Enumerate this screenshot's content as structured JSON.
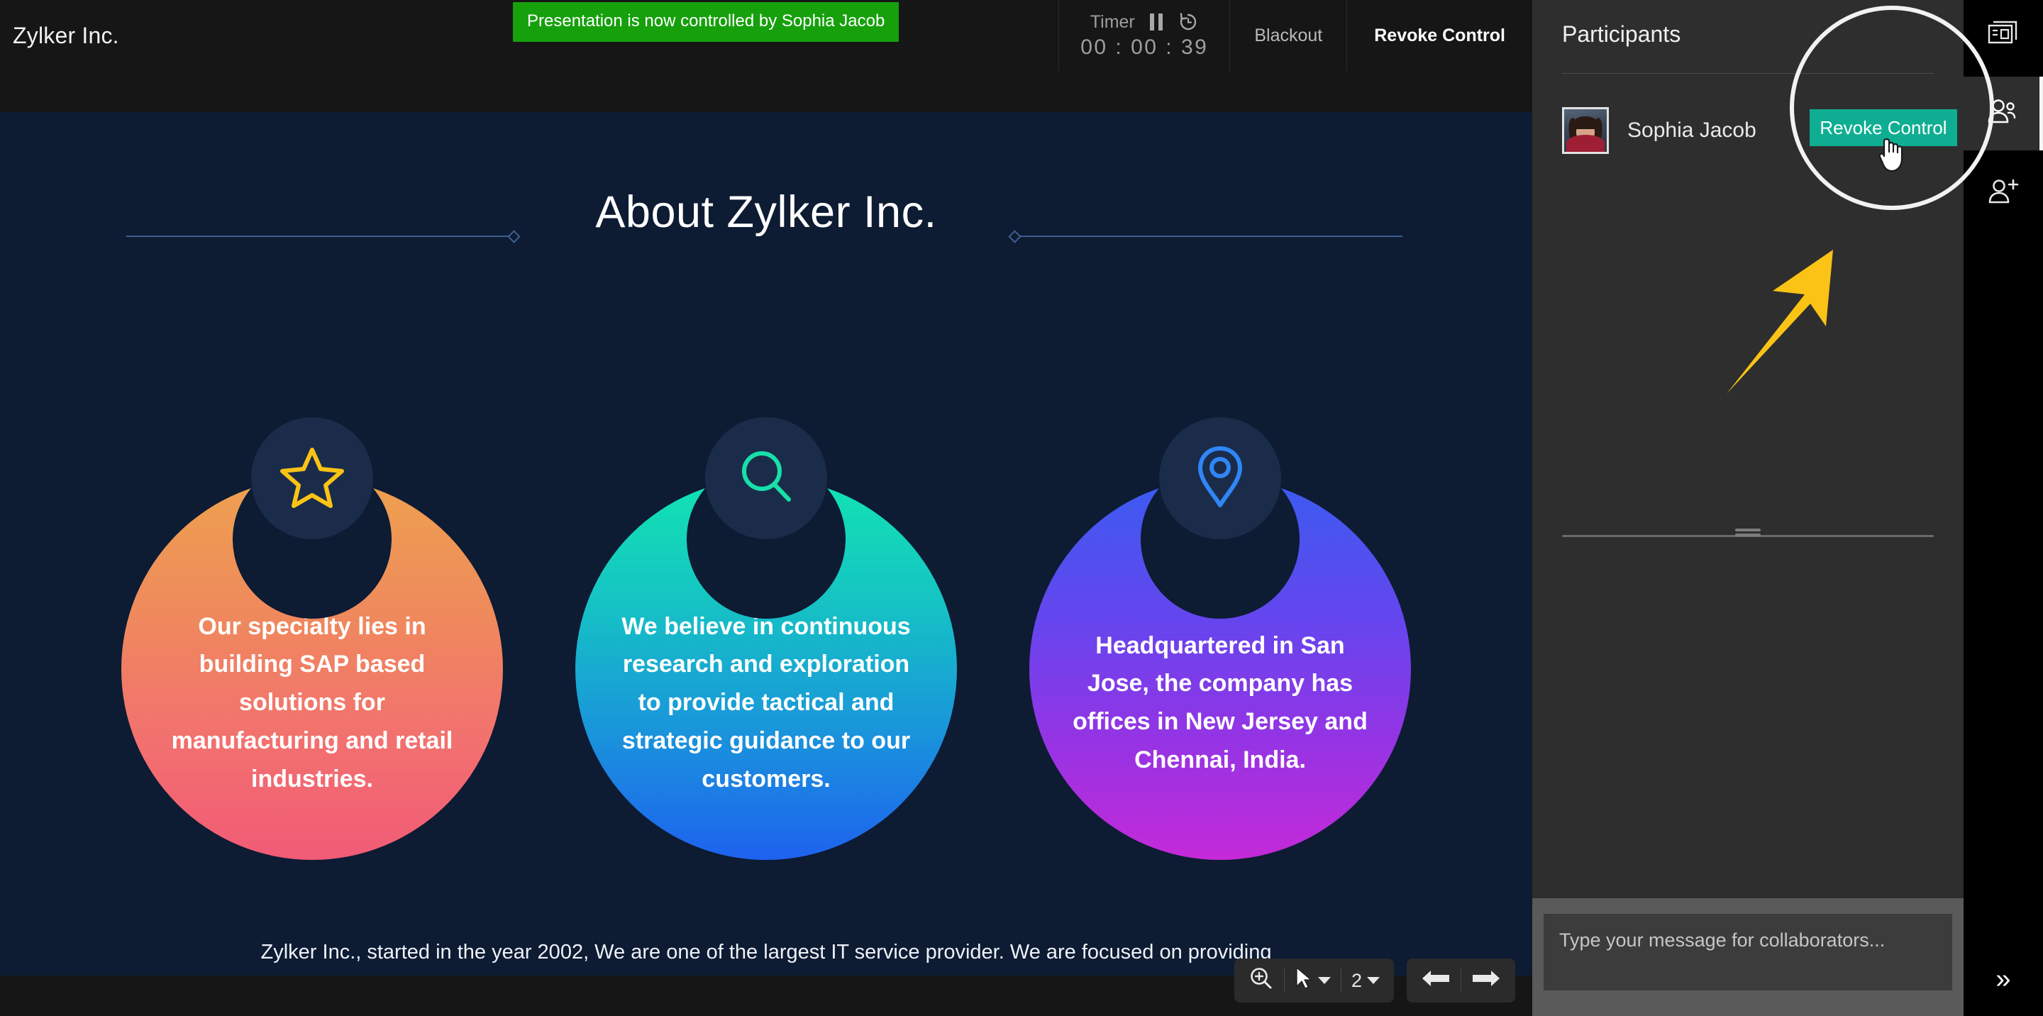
{
  "app": {
    "deck_title": "Zylker Inc.",
    "toast_message": "Presentation is now controlled by Sophia Jacob"
  },
  "topbar": {
    "timer_label": "Timer",
    "timer_value": "00 : 00 : 39",
    "pause_icon": "pause-icon",
    "reset_icon": "timer-reset-icon",
    "blackout_label": "Blackout",
    "revoke_label": "Revoke Control"
  },
  "slide": {
    "title": "About Zylker Inc.",
    "cards": [
      {
        "icon": "star-icon",
        "icon_color": "#fbc316",
        "text": "Our specialty lies in building SAP based solutions for manufacturing and retail industries.",
        "gradient_from": "#eda14f",
        "gradient_to": "#f15b76"
      },
      {
        "icon": "search-icon",
        "icon_color": "#17e0a9",
        "text": "We believe in continuous research and exploration to provide tactical and strategic guidance to our customers.",
        "gradient_from": "#12e3b2",
        "gradient_to": "#1e62ef"
      },
      {
        "icon": "location-pin-icon",
        "icon_color": "#2f86f7",
        "text": "Headquartered in San Jose, the company has offices in New Jersey and Chennai, India.",
        "gradient_from": "#3a5cf0",
        "gradient_to": "#c42ad8"
      }
    ],
    "paragraph": "Zylker Inc., started in the year 2002, We are one of the largest IT service provider. We are focused on providing best in class IT solutions to our customers through our domain expertise and best practices.",
    "background": "#0d1b33"
  },
  "slide_toolbar": {
    "zoom_icon": "zoom-in-icon",
    "pointer_icon": "pointer-icon",
    "pointer_caret": "chevron-down-icon",
    "page_number": "2",
    "page_caret": "chevron-down-icon",
    "prev_icon": "arrow-left-icon",
    "next_icon": "arrow-right-icon"
  },
  "participants_panel": {
    "title": "Participants",
    "list": [
      {
        "name": "Sophia Jacob",
        "avatar": "user-avatar"
      }
    ],
    "resize_handle": "panel-resize-handle",
    "chat_placeholder": "Type your message for collaborators..."
  },
  "rail": {
    "items": [
      {
        "icon": "presenter-notes-icon",
        "active": false
      },
      {
        "icon": "participants-icon",
        "active": true
      },
      {
        "icon": "add-participant-icon",
        "active": false
      }
    ],
    "collapse_icon": "chevron-double-right-icon",
    "collapse_glyph": "»"
  },
  "annotation": {
    "spotlight": "highlight-circle",
    "arrow": "callout-arrow",
    "arrow_color": "#fbc316",
    "tooltip_button_label": "Revoke Control",
    "tooltip_button_color": "#0fae92",
    "cursor": "pointing-hand-cursor"
  }
}
